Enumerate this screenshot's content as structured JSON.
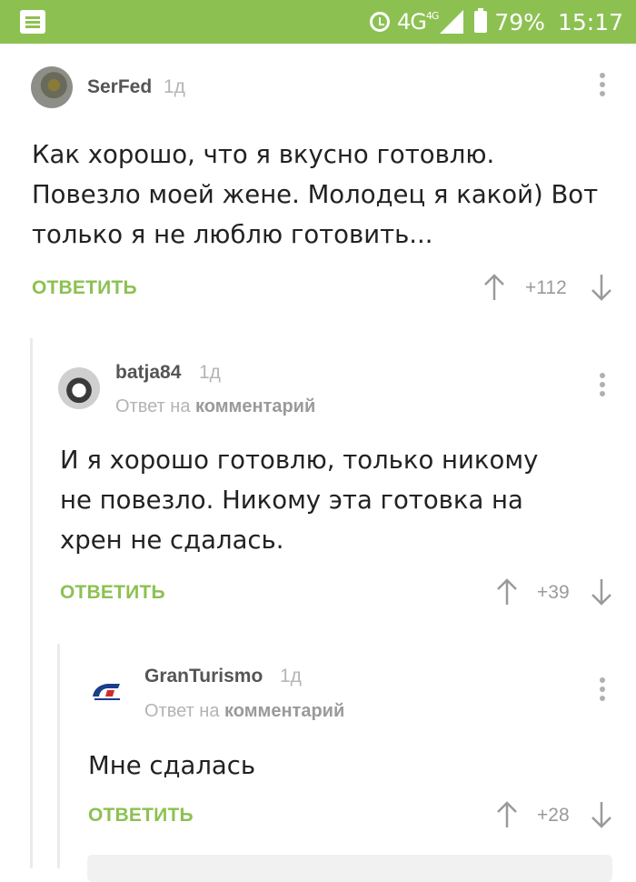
{
  "status_bar": {
    "network": "4G",
    "network_small": "4G",
    "battery": "79%",
    "time": "15:17",
    "icons": [
      "app-notification-icon",
      "alarm-icon",
      "signal-icon",
      "battery-icon"
    ]
  },
  "comments": [
    {
      "author": "SerFed",
      "age": "1д",
      "text_lines": [
        "Как хорошо, что я вкусно готовлю.",
        "Повезло моей жене. Молодец я какой) Вот",
        "только я не люблю готовить..."
      ],
      "reply_label": "ОТВЕТИТЬ",
      "rating": "+112"
    },
    {
      "author": "batja84",
      "age": "1д",
      "reply_to_prefix": "Ответ на",
      "reply_to_target": "комментарий",
      "text_lines": [
        "И я хорошо готовлю, только никому",
        "не повезло. Никому эта готовка на",
        "хрен не сдалась."
      ],
      "reply_label": "ОТВЕТИТЬ",
      "rating": "+39"
    },
    {
      "author": "GranTurismo",
      "age": "1д",
      "reply_to_prefix": "Ответ на",
      "reply_to_target": "комментарий",
      "text_lines": [
        "Мне сдалась"
      ],
      "reply_label": "ОТВЕТИТЬ",
      "rating": "+28"
    }
  ],
  "colors": {
    "accent": "#8cc152",
    "text": "#222222",
    "muted": "#b5b5b5"
  }
}
